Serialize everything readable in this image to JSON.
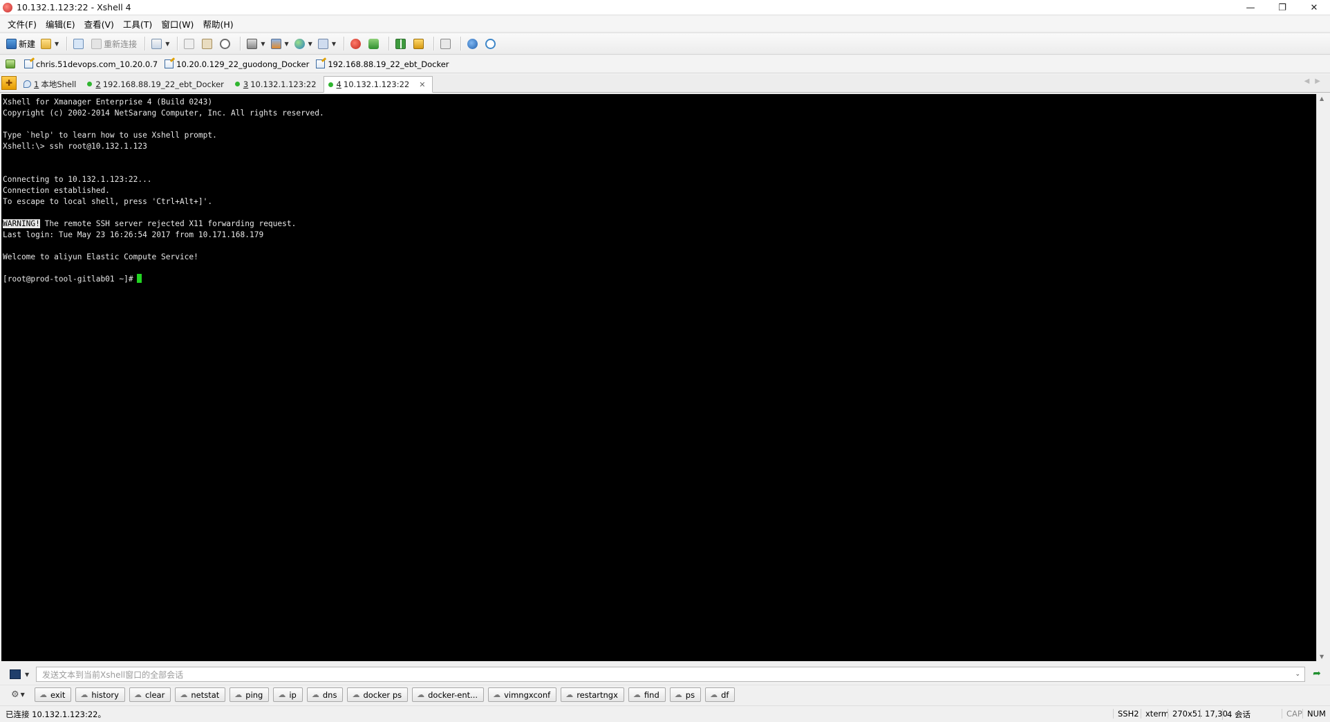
{
  "window": {
    "title": "10.132.1.123:22 - Xshell 4"
  },
  "menu": [
    "文件(F)",
    "编辑(E)",
    "查看(V)",
    "工具(T)",
    "窗口(W)",
    "帮助(H)"
  ],
  "toolbar": {
    "new_label": "新建",
    "reconnect_label": "重新连接"
  },
  "links": [
    "chris.51devops.com_10.20.0.7",
    "10.20.0.129_22_guodong_Docker",
    "192.168.88.19_22_ebt_Docker"
  ],
  "tabs": [
    {
      "num": "1",
      "label": "本地Shell"
    },
    {
      "num": "2",
      "label": "192.168.88.19_22_ebt_Docker"
    },
    {
      "num": "3",
      "label": "10.132.1.123:22"
    },
    {
      "num": "4",
      "label": "10.132.1.123:22"
    }
  ],
  "terminal": {
    "lines": [
      "Xshell for Xmanager Enterprise 4 (Build 0243)",
      "Copyright (c) 2002-2014 NetSarang Computer, Inc. All rights reserved.",
      "",
      "Type `help' to learn how to use Xshell prompt.",
      "Xshell:\\> ssh root@10.132.1.123",
      "",
      "",
      "Connecting to 10.132.1.123:22...",
      "Connection established.",
      "To escape to local shell, press 'Ctrl+Alt+]'."
    ],
    "warning_tag": "WARNING!",
    "warning_text": " The remote SSH server rejected X11 forwarding request.",
    "last_login": "Last login: Tue May 23 16:26:54 2017 from 10.171.168.179",
    "welcome": "Welcome to aliyun Elastic Compute Service!",
    "prompt": "[root@prod-tool-gitlab01 ~]#"
  },
  "compose": {
    "placeholder": "发送文本到当前Xshell窗口的全部会话"
  },
  "quick_commands": [
    "exit",
    "history",
    "clear",
    "netstat",
    "ping",
    "ip",
    "dns",
    "docker ps",
    "docker-ent...",
    "vimngxconf",
    "restartngx",
    "find",
    "ps",
    "df"
  ],
  "status": {
    "connection": "已连接 10.132.1.123:22。",
    "protocol": "SSH2",
    "term": "xterm",
    "size": "270x51",
    "pos": "17,30",
    "sessions": "4 会话",
    "cap": "CAP",
    "num": "NUM"
  }
}
